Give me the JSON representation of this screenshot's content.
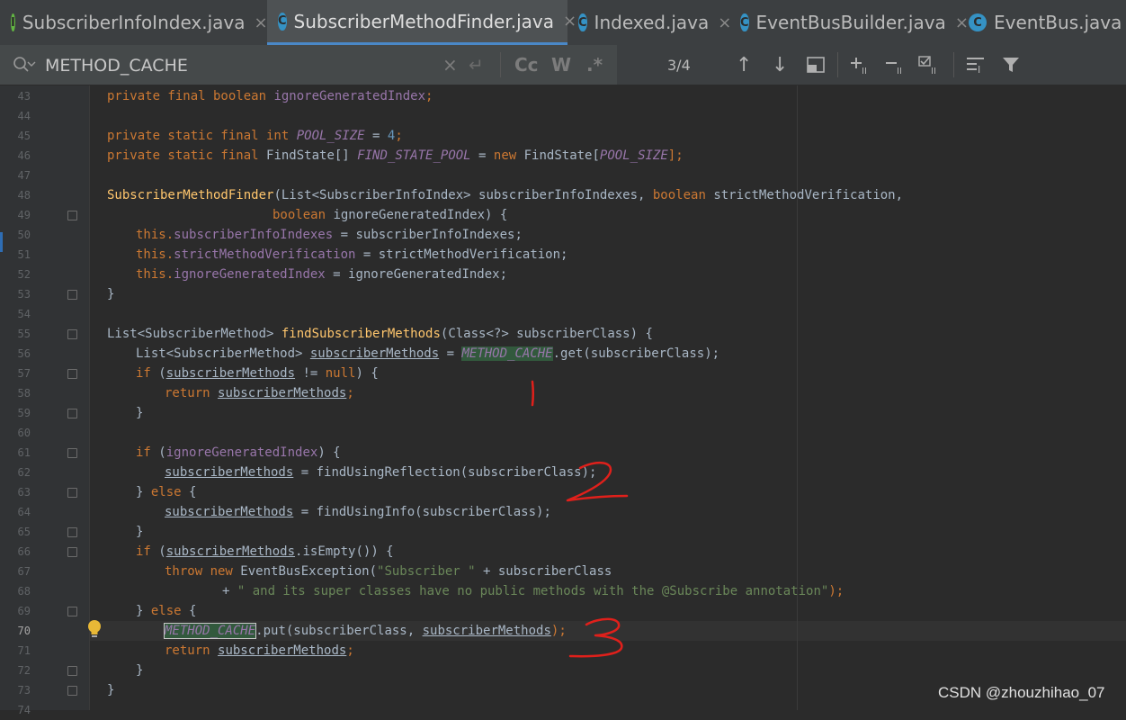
{
  "tabs": [
    {
      "label": "SubscriberInfoIndex.java",
      "icon": "interface-icon",
      "active": false
    },
    {
      "label": "SubscriberMethodFinder.java",
      "icon": "class-icon",
      "active": true
    },
    {
      "label": "Indexed.java",
      "icon": "class-icon",
      "active": false
    },
    {
      "label": "EventBusBuilder.java",
      "icon": "class-icon",
      "active": false
    },
    {
      "label": "EventBus.java",
      "icon": "class-icon",
      "active": false
    }
  ],
  "search": {
    "query": "METHOD_CACHE",
    "match_case_label": "Cc",
    "words_label": "W",
    "regex_label": ".*",
    "match_count": "3/4"
  },
  "line_numbers": [
    "43",
    "44",
    "45",
    "46",
    "47",
    "48",
    "49",
    "50",
    "51",
    "52",
    "53",
    "54",
    "55",
    "56",
    "57",
    "58",
    "59",
    "60",
    "61",
    "62",
    "63",
    "64",
    "65",
    "66",
    "67",
    "68",
    "69",
    "70",
    "71",
    "72",
    "73",
    "74"
  ],
  "code": {
    "l43": {
      "a": "private final boolean ",
      "b": "ignoreGeneratedIndex",
      "c": ";"
    },
    "l45": {
      "a": "private static final int ",
      "b": "POOL_SIZE",
      "c": " = ",
      "d": "4",
      "e": ";"
    },
    "l46": {
      "a": "private static final ",
      "b": "FindState[] ",
      "c": "FIND_STATE_POOL",
      "d": " = ",
      "e": "new ",
      "f": "FindState[",
      "g": "POOL_SIZE",
      "h": "];"
    },
    "l48": {
      "a": "SubscriberMethodFinder",
      "b": "(List<SubscriberInfoIndex> subscriberInfoIndexes, ",
      "c": "boolean ",
      "d": "strictMethodVerification,"
    },
    "l49": {
      "a": "boolean ",
      "b": "ignoreGeneratedIndex) {"
    },
    "l50": {
      "a": "this.",
      "b": "subscriberInfoIndexes",
      "c": " = subscriberInfoIndexes;"
    },
    "l51": {
      "a": "this.",
      "b": "strictMethodVerification",
      "c": " = strictMethodVerification;"
    },
    "l52": {
      "a": "this.",
      "b": "ignoreGeneratedIndex",
      "c": " = ignoreGeneratedIndex;"
    },
    "l53": {
      "a": "}"
    },
    "l55": {
      "a": "List<SubscriberMethod> ",
      "b": "findSubscriberMethods",
      "c": "(Class<?> subscriberClass) {"
    },
    "l56": {
      "a": "List<SubscriberMethod> ",
      "b": "subscriberMethods",
      "c": " = ",
      "d": "METHOD_CACHE",
      "e": ".get(subscriberClass);"
    },
    "l57": {
      "a": "if ",
      "b": "(",
      "c": "subscriberMethods",
      "d": " != ",
      "e": "null",
      "f": ") {"
    },
    "l58": {
      "a": "return ",
      "b": "subscriberMethods",
      "c": ";"
    },
    "l59": {
      "a": "}"
    },
    "l61": {
      "a": "if ",
      "b": "(",
      "c": "ignoreGeneratedIndex",
      "d": ") {"
    },
    "l62": {
      "a": "subscriberMethods",
      "b": " = findUsingReflection(subscriberClass);"
    },
    "l63": {
      "a": "} ",
      "b": "else ",
      "c": "{"
    },
    "l64": {
      "a": "subscriberMethods",
      "b": " = findUsingInfo(subscriberClass);"
    },
    "l65": {
      "a": "}"
    },
    "l66": {
      "a": "if ",
      "b": "(",
      "c": "subscriberMethods",
      ".": "",
      "d": ".isEmpty()) {"
    },
    "l67": {
      "a": "throw new ",
      "b": "EventBusException(",
      "c": "\"Subscriber \"",
      "d": " + subscriberClass"
    },
    "l68": {
      "a": "+ ",
      "b": "\" and its super classes have no public methods with the @Subscribe annotation\"",
      "c": ");"
    },
    "l69": {
      "a": "} ",
      "b": "else ",
      "c": "{"
    },
    "l70": {
      "a": "METHOD_CACHE",
      "b": ".put(subscriberClass, ",
      "c": "subscriberMethods",
      "d": ");"
    },
    "l71": {
      "a": "return ",
      "b": "subscriberMethods",
      "c": ";"
    },
    "l72": {
      "a": "}"
    },
    "l73": {
      "a": "}"
    }
  },
  "annotations": {
    "mark1": "1",
    "mark2": "2",
    "mark3": "3",
    "color": "#e0201b"
  },
  "watermark": "CSDN @zhouzhihao_07"
}
